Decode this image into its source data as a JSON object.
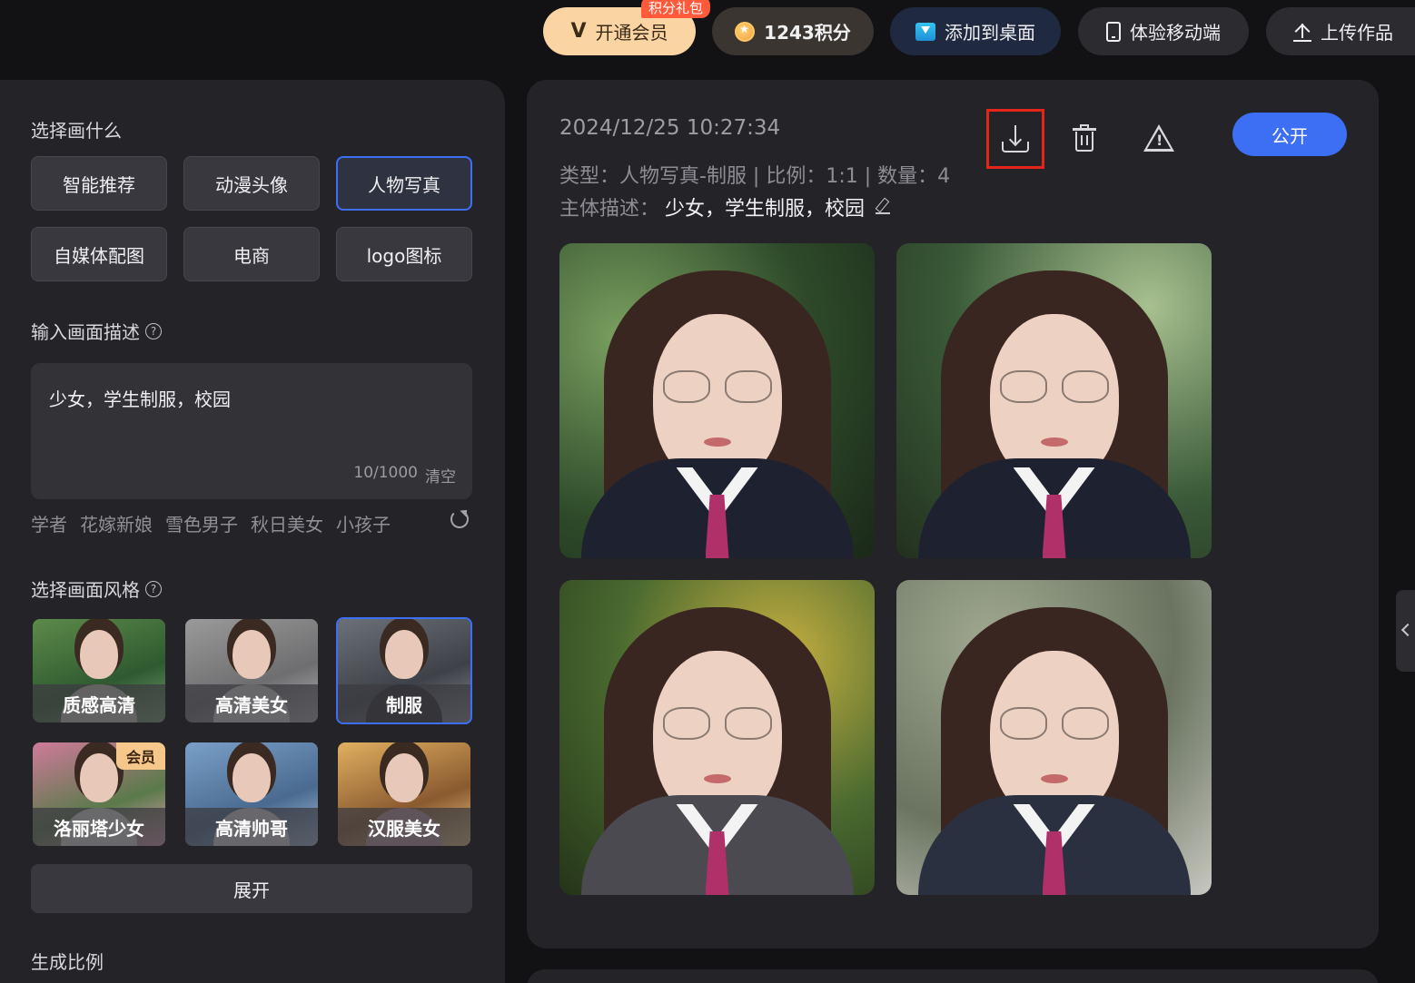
{
  "topbar": {
    "vip_label": "开通会员",
    "vip_badge": "积分礼包",
    "points_label": "1243积分",
    "desktop_label": "添加到桌面",
    "mobile_label": "体验移动端",
    "upload_label": "上传作品"
  },
  "left": {
    "section_what": "选择画什么",
    "categories": [
      "智能推荐",
      "动漫头像",
      "人物写真",
      "自媒体配图",
      "电商",
      "logo图标"
    ],
    "active_category": "人物写真",
    "section_desc": "输入画面描述",
    "desc_text": "少女，学生制服，校园",
    "desc_count": "10/1000",
    "clear_label": "清空",
    "suggestions": [
      "学者",
      "花嫁新娘",
      "雪色男子",
      "秋日美女",
      "小孩子"
    ],
    "section_style": "选择画面风格",
    "styles": [
      "质感高清",
      "高清美女",
      "制服",
      "洛丽塔少女",
      "高清帅哥",
      "汉服美女"
    ],
    "active_style": "制服",
    "vip_tag": "会员",
    "expand_label": "展开",
    "section_ratio": "生成比例"
  },
  "result": {
    "date": "2024/12/25 10:27:34",
    "meta": "类型：人物写真-制服 | 比例：1:1 | 数量：4",
    "desc_prefix": "主体描述：",
    "desc_value": "少女，学生制服，校园",
    "public_label": "公开",
    "images_count": 4
  },
  "colors": {
    "accent": "#3d6ff5",
    "highlight": "#e5251b",
    "vip": "#fad4a2"
  }
}
